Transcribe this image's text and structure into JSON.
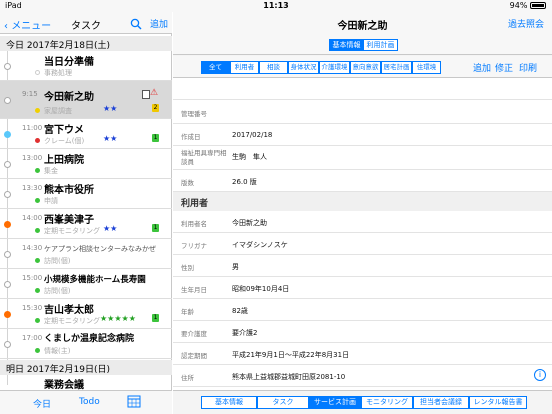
{
  "status": {
    "carrier": "iPad",
    "time": "11:13",
    "battery": "94%"
  },
  "left": {
    "back_label": "メニュー",
    "title": "タスク",
    "add_label": "追加",
    "days": [
      {
        "header": "今日 2017年2月18日(土)"
      },
      {
        "header": "明日 2017年2月19日(日)"
      }
    ],
    "tasks": [
      {
        "time": "",
        "name": "当日分準備",
        "sub": "事務処理",
        "dot": "#ffffff",
        "stars": "",
        "badge": ""
      },
      {
        "time": "9:15",
        "name": "今田新之助",
        "sub": "家屋調査",
        "dot": "#f0d000",
        "stars": "★★",
        "badge": "2"
      },
      {
        "time": "11:00",
        "name": "宮下ウメ",
        "sub": "クレーム(個)",
        "dot": "#e03030",
        "stars": "★★",
        "badge": "1"
      },
      {
        "time": "13:00",
        "name": "上田病院",
        "sub": "集金",
        "dot": "#3cc43c",
        "stars": "",
        "badge": ""
      },
      {
        "time": "13:30",
        "name": "熊本市役所",
        "sub": "申請",
        "dot": "#3cc43c",
        "stars": "",
        "badge": ""
      },
      {
        "time": "14:00",
        "name": "西峯美津子",
        "sub": "定期モニタリング",
        "dot": "#3cc43c",
        "stars": "★★",
        "badge": "1"
      },
      {
        "time": "14:30",
        "name": "ケアプラン相談センターみなみかぜ",
        "sub": "訪問(個)",
        "dot": "#3cc43c",
        "stars": "",
        "badge": ""
      },
      {
        "time": "15:00",
        "name": "小規模多機能ホーム長寿園",
        "sub": "訪問(個)",
        "dot": "#3cc43c",
        "stars": "",
        "badge": ""
      },
      {
        "time": "15:30",
        "name": "吉山孝太郎",
        "sub": "定期モニタリング",
        "dot": "#3cc43c",
        "stars": "★★★★★",
        "badge": "1"
      },
      {
        "time": "17:00",
        "name": "くましか温泉記念病院",
        "sub": "情報(主)",
        "dot": "#3cc43c",
        "stars": "",
        "badge": ""
      },
      {
        "time": "",
        "name": "業務会議",
        "sub": "",
        "dot": "#3cc43c",
        "stars": "",
        "badge": ""
      }
    ],
    "tabbar": {
      "today": "今日",
      "todo": "Todo"
    }
  },
  "right": {
    "title": "今田新之助",
    "right_action": "過去照会",
    "segments": [
      "基本情報",
      "利用計画"
    ],
    "filters": [
      "全て",
      "利用者",
      "相談",
      "身体状況",
      "介護環境",
      "意向意欲",
      "居宅計画",
      "住環境"
    ],
    "actions": [
      "追加",
      "修正",
      "印刷"
    ],
    "fields_top": [
      {
        "key": "管理番号",
        "value": ""
      },
      {
        "key": "作成日",
        "value": "2017/02/18"
      },
      {
        "key": "福祉用具専門相談員",
        "value": "生駒　隼人"
      },
      {
        "key": "版数",
        "value": "26.0 版"
      }
    ],
    "section_user": "利用者",
    "fields_user": [
      {
        "key": "利用者名",
        "value": "今田新之助"
      },
      {
        "key": "フリガナ",
        "value": "イマダシンノスケ"
      },
      {
        "key": "性別",
        "value": "男"
      },
      {
        "key": "生年月日",
        "value": "昭和09年10月4日"
      },
      {
        "key": "年齢",
        "value": "82歳"
      },
      {
        "key": "要介護度",
        "value": "要介護2"
      },
      {
        "key": "認定期間",
        "value": "平成21年9月1日〜平成22年8月31日"
      },
      {
        "key": "住所",
        "value": "熊本県上益城郡益城町田原2081-10"
      }
    ],
    "bottom_tabs": [
      "基本情報",
      "タスク",
      "サービス計画",
      "モニタリング",
      "担当者会議録",
      "レンタル報告書"
    ]
  }
}
